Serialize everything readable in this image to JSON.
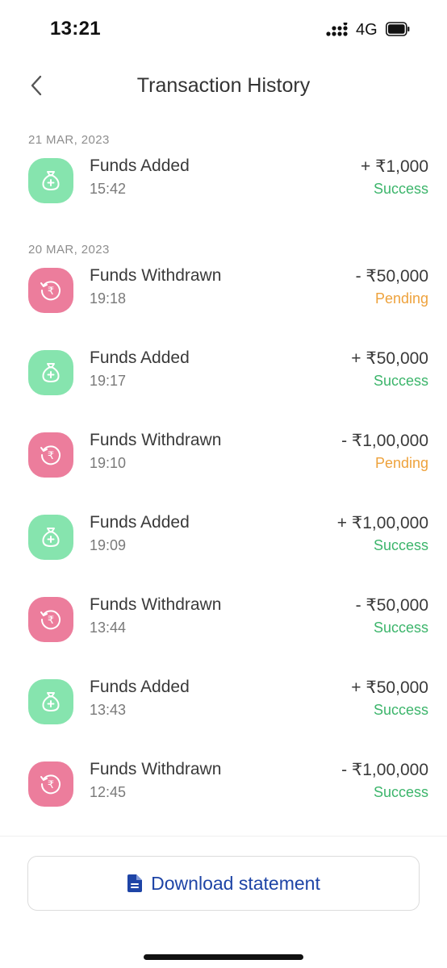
{
  "status_bar": {
    "time": "13:21",
    "network": "4G"
  },
  "header": {
    "title": "Transaction History"
  },
  "groups": [
    {
      "date": "21 MAR, 2023",
      "items": [
        {
          "type": "add",
          "title": "Funds Added",
          "time": "15:42",
          "amount": "+ ₹1,000",
          "status": "Success"
        }
      ]
    },
    {
      "date": "20 MAR, 2023",
      "items": [
        {
          "type": "withdraw",
          "title": "Funds Withdrawn",
          "time": "19:18",
          "amount": "- ₹50,000",
          "status": "Pending"
        },
        {
          "type": "add",
          "title": "Funds Added",
          "time": "19:17",
          "amount": "+ ₹50,000",
          "status": "Success"
        },
        {
          "type": "withdraw",
          "title": "Funds Withdrawn",
          "time": "19:10",
          "amount": "- ₹1,00,000",
          "status": "Pending"
        },
        {
          "type": "add",
          "title": "Funds Added",
          "time": "19:09",
          "amount": "+ ₹1,00,000",
          "status": "Success"
        },
        {
          "type": "withdraw",
          "title": "Funds Withdrawn",
          "time": "13:44",
          "amount": "- ₹50,000",
          "status": "Success"
        },
        {
          "type": "add",
          "title": "Funds Added",
          "time": "13:43",
          "amount": "+ ₹50,000",
          "status": "Success"
        },
        {
          "type": "withdraw",
          "title": "Funds Withdrawn",
          "time": "12:45",
          "amount": "- ₹1,00,000",
          "status": "Success"
        }
      ]
    }
  ],
  "footer": {
    "download_label": "Download statement"
  },
  "colors": {
    "success": "#3cb56b",
    "pending": "#eea23c",
    "add_icon_bg": "#86e4ae",
    "withdraw_icon_bg": "#ec7d9c",
    "accent": "#1e44a6"
  },
  "icons": {
    "add": "money-bag-plus-icon",
    "withdraw": "rupee-refresh-icon",
    "back": "chevron-left-icon",
    "download": "document-icon"
  }
}
